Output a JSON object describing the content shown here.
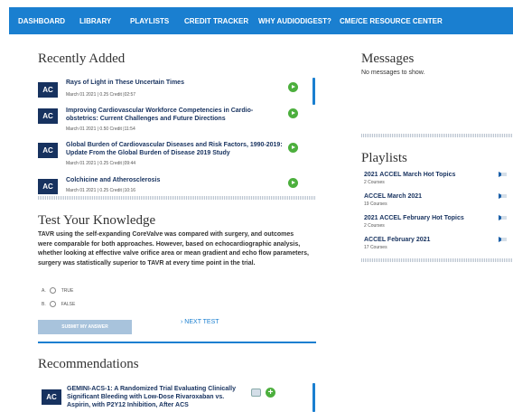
{
  "nav": {
    "items": [
      {
        "label": "DASHBOARD"
      },
      {
        "label": "LIBRARY"
      },
      {
        "label": "PLAYLISTS"
      },
      {
        "label": "CREDIT TRACKER"
      },
      {
        "label": "WHY AUDIODIGEST?"
      },
      {
        "label": "CME/CE RESOURCE CENTER"
      }
    ]
  },
  "recently_added": {
    "title": "Recently Added",
    "badge": "AC",
    "items": [
      {
        "title": "Rays of Light in These Uncertain Times",
        "meta": "March 01 2021 | 0.25 Credit |02:57"
      },
      {
        "title": "Improving Cardiovascular Workforce Competencies in Cardio-obstetrics: Current Challenges and Future Directions",
        "meta": "March 01 2021 | 0.50 Credit |11:54"
      },
      {
        "title": "Global Burden of Cardiovascular Diseases and Risk Factors, 1990-2019: Update From the Global Burden of Disease 2019 Study",
        "meta": "March 01 2021 | 0.25 Credit |09:44"
      },
      {
        "title": "Colchicine and Atherosclerosis",
        "meta": "March 01 2021 | 0.25 Credit |10:16"
      }
    ]
  },
  "knowledge": {
    "title": "Test Your Knowledge",
    "question": "TAVR using the self-expanding CoreValve was compared with surgery, and outcomes were comparable for both approaches. However, based on echocardiographic analysis, whether looking at effective valve orifice area or mean gradient and echo flow parameters, surgery was statistically superior to TAVR at every time point in the trial.",
    "options": [
      {
        "letter": "A.",
        "label": "TRUE"
      },
      {
        "letter": "B.",
        "label": "FALSE"
      }
    ],
    "submit_label": "SUBMIT MY ANSWER",
    "next_label": "NEXT TEST"
  },
  "recommendations": {
    "title": "Recommendations",
    "badge": "AC",
    "items": [
      {
        "title": "GEMINI-ACS-1: A Randomized Trial Evaluating Clinically Significant Bleeding with Low-Dose Rivaroxaban vs. Aspirin, with P2Y12 Inhibition, After ACS"
      }
    ]
  },
  "messages": {
    "title": "Messages",
    "empty_text": "No messages to show."
  },
  "playlists": {
    "title": "Playlists",
    "items": [
      {
        "title": "2021 ACCEL March Hot Topics",
        "count": "2 Courses"
      },
      {
        "title": "ACCEL March 2021",
        "count": "19 Courses"
      },
      {
        "title": "2021 ACCEL February Hot Topics",
        "count": "2 Courses"
      },
      {
        "title": "ACCEL February 2021",
        "count": "17 Courses"
      }
    ]
  },
  "colors": {
    "nav_bg": "#1a7fd0",
    "badge_bg": "#17325f",
    "play_green": "#4caf3d"
  }
}
